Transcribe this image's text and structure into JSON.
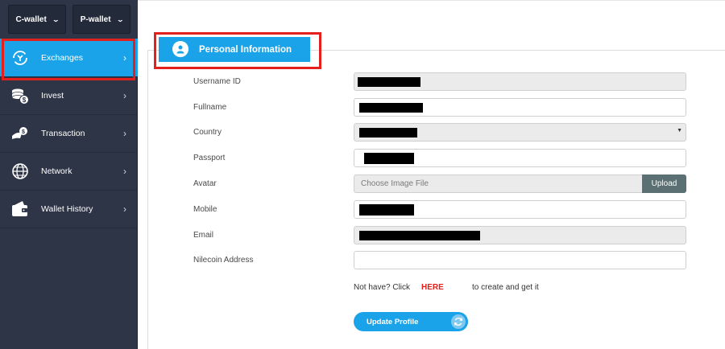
{
  "wallets": {
    "c_wallet": "C-wallet",
    "p_wallet": "P-wallet"
  },
  "sidebar": {
    "items": [
      {
        "label": "Exchanges",
        "icon": "exchange-icon",
        "active": true
      },
      {
        "label": "Invest",
        "icon": "coins-icon",
        "active": false
      },
      {
        "label": "Transaction",
        "icon": "money-transfer-icon",
        "active": false
      },
      {
        "label": "Network",
        "icon": "globe-icon",
        "active": false
      },
      {
        "label": "Wallet History",
        "icon": "wallet-icon",
        "active": false
      }
    ]
  },
  "profile": {
    "tab_label": "Personal Information",
    "fields": {
      "username_label": "Username ID",
      "fullname_label": "Fullname",
      "country_label": "Country",
      "passport_label": "Passport",
      "avatar_label": "Avatar",
      "mobile_label": "Mobile",
      "email_label": "Email",
      "nilecoin_label": "Nilecoin Address"
    },
    "avatar_placeholder": "Choose Image File",
    "upload_label": "Upload",
    "note_prefix": "Not have? Click",
    "note_link": "HERE",
    "note_suffix": "to create and get it",
    "update_button": "Update Profile"
  },
  "colors": {
    "accent": "#1aa3e8",
    "sidebar_bg": "#2e3546",
    "highlight": "#e3201b",
    "link": "#e3201b"
  }
}
